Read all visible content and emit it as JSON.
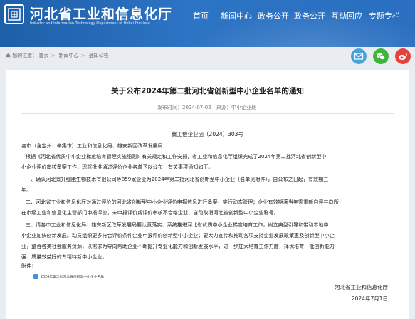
{
  "header": {
    "site_title": "河北省工业和信息化厅",
    "site_subtitle": "Industry and Information Technology Department of Hebei Province",
    "nav": [
      {
        "label": "首页",
        "active": false
      },
      {
        "label": "新闻中心",
        "active": false
      },
      {
        "label": "政务公开",
        "active": false
      },
      {
        "label": "政务公开",
        "active": false
      },
      {
        "label": "互动回应",
        "active": false
      },
      {
        "label": "专题专栏",
        "active": false
      }
    ]
  },
  "breadcrumb": {
    "prefix": "您的位置：",
    "items": [
      "首页",
      "新闻中心",
      "通知公告"
    ]
  },
  "share": [
    {
      "icon": "email-icon",
      "color": "#4aa3d8"
    },
    {
      "icon": "wechat-icon",
      "color": "#3fb33a"
    },
    {
      "icon": "weibo-icon",
      "color": "#e6423c"
    }
  ],
  "article": {
    "title": "关于公布2024年第二批河北省创新型中小企业名单的通知",
    "date_label": "发布时间：",
    "date": "2024-07-02",
    "source_label": "来源：",
    "source": "中小企业处",
    "doc_number": "冀工信企业函〔2024〕303号",
    "addressee": "各市（含定州、辛集市）工业和信息化局、雄安新区改革发展局：",
    "paragraphs": [
      [
        "根据《河北省优质中小企业梯度培育管理实施细则》有关规定和工作安排，省工业和信息化厅组织完成了2024年第二批河北省创新型中",
        "小企业评价审核备案工作，现将批准通过评价企业名单予以公布，有关事项通知如下。"
      ],
      [
        "一、确认河北景升细胞生物技术有限公司等859家企业为2024年第二批河北省创新型中小企业（名单见附件），自公布之日起，有效期三",
        "年。"
      ],
      [
        "二、河北省工业和信息化厅对通过评价的河北省创新型中小企业评价申报信息进行备案，实行动态管理；企业有效期满当年需重新自评并向所",
        "在市级工业和信息化主管部门申报评价，未申报评价或评价审核不合格企业，自动取消河北省创新型中小企业称号。"
      ],
      [
        "三、请各市工业和信息化局、雄安新区改革发展局要认真落实、系统推进河北省优质中小企业梯度培育工作，树立典型引导和带动本地中",
        "小企业加快创新发展。动员组织更多符合评价条件企业申报评价创新型中小企业；要大力宣传和推动各项支持企业发展政策惠及创新型中小企",
        "业，整合各类社会服务资源，以需求为导向帮助企业不断提升专业化能力和创新发展水平，进一步加大培育工作力度，择优培育一批创新能力",
        "强、质量效益好的专精特新中小企业。"
      ]
    ],
    "attachment_label": "附件：",
    "attachment_name": "2024年第二批河北省创新型中小企业名单",
    "signature": "河北省工业和信息化厅",
    "signature_date": "2024年7月1日"
  }
}
